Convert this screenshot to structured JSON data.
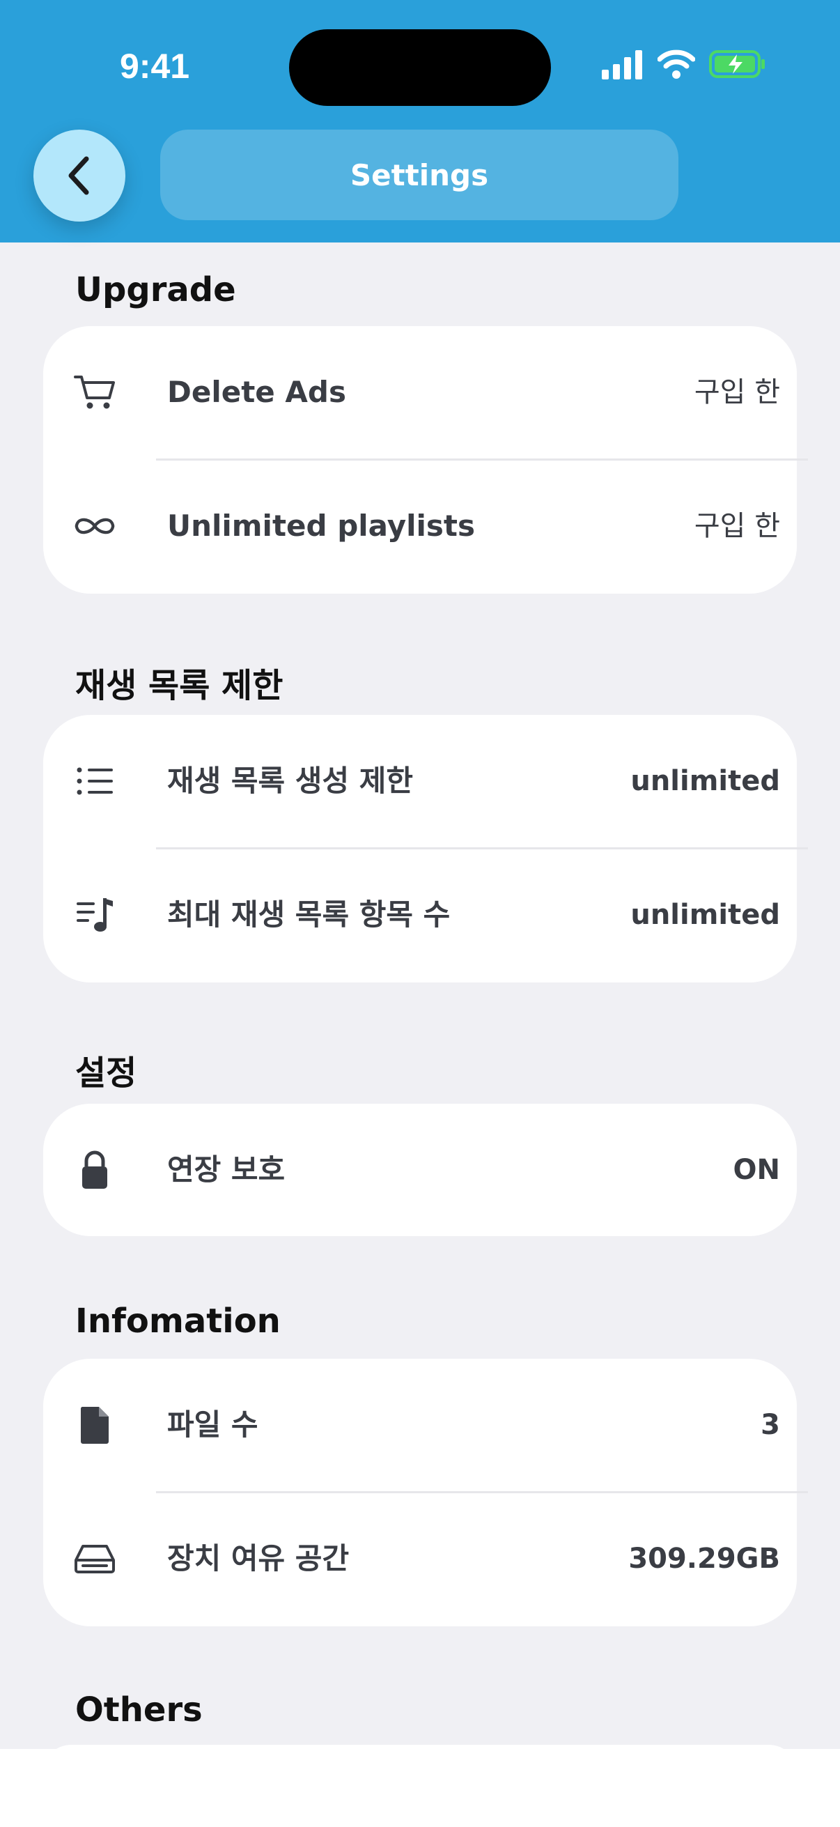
{
  "status_bar": {
    "time": "9:41"
  },
  "header": {
    "title": "Settings"
  },
  "colors": {
    "header": "#2aa0da",
    "back_button": "#b3e7fb",
    "battery": "#4cd964"
  },
  "sections": [
    {
      "title": "Upgrade",
      "rows": [
        {
          "icon": "cart-icon",
          "label": "Delete Ads",
          "value": "구입 한"
        },
        {
          "icon": "infinity-icon",
          "label": "Unlimited playlists",
          "value": "구입 한"
        }
      ]
    },
    {
      "title": "재생 목록 제한",
      "rows": [
        {
          "icon": "list-icon",
          "label": "재생 목록 생성 제한",
          "value": "unlimited"
        },
        {
          "icon": "music-list-icon",
          "label": "최대 재생 목록 항목 수",
          "value": "unlimited"
        }
      ]
    },
    {
      "title": "설정",
      "rows": [
        {
          "icon": "lock-icon",
          "label": "연장 보호",
          "value": "ON"
        }
      ]
    },
    {
      "title": "Infomation",
      "rows": [
        {
          "icon": "file-icon",
          "label": "파일 수",
          "value": "3"
        },
        {
          "icon": "drive-icon",
          "label": "장치 여유 공간",
          "value": "309.29GB"
        }
      ]
    },
    {
      "title": "Others",
      "rows": []
    }
  ]
}
